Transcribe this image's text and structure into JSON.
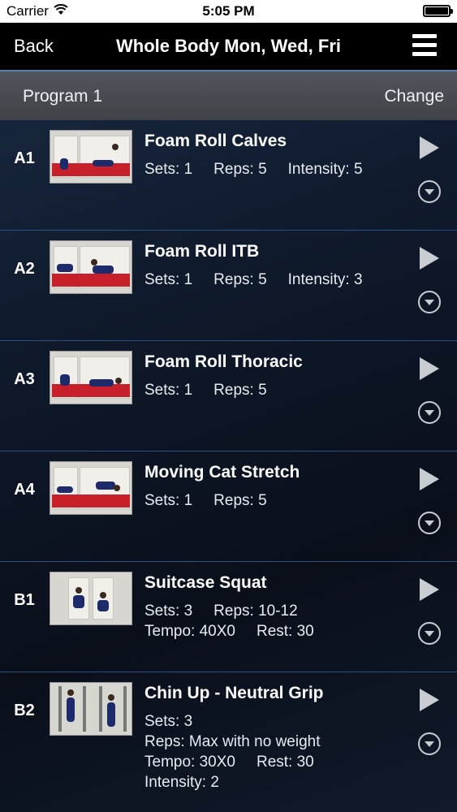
{
  "status_bar": {
    "carrier": "Carrier",
    "time": "5:05 PM",
    "battery_level": 1.0
  },
  "nav": {
    "back_label": "Back",
    "title": "Whole Body Mon, Wed, Fri",
    "menu_icon": "hamburger-menu-icon"
  },
  "program": {
    "label": "Program 1",
    "change_label": "Change"
  },
  "exercises": [
    {
      "code": "A1",
      "name": "Foam Roll Calves",
      "lines": [
        [
          "Sets: 1",
          "Reps: 5",
          "Intensity: 5"
        ]
      ]
    },
    {
      "code": "A2",
      "name": "Foam Roll ITB",
      "lines": [
        [
          "Sets: 1",
          "Reps: 5",
          "Intensity: 3"
        ]
      ]
    },
    {
      "code": "A3",
      "name": "Foam Roll Thoracic",
      "lines": [
        [
          "Sets: 1",
          "Reps: 5"
        ]
      ]
    },
    {
      "code": "A4",
      "name": "Moving Cat Stretch",
      "lines": [
        [
          "Sets: 1",
          "Reps: 5"
        ]
      ]
    },
    {
      "code": "B1",
      "name": "Suitcase Squat",
      "lines": [
        [
          "Sets: 3",
          "Reps: 10-12"
        ],
        [
          "Tempo: 40X0",
          "Rest: 30"
        ]
      ]
    },
    {
      "code": "B2",
      "name": "Chin Up - Neutral Grip",
      "lines": [
        [
          "Sets: 3"
        ],
        [
          "Reps: Max with no weight"
        ],
        [
          "Tempo: 30X0",
          "Rest: 30"
        ],
        [
          "Intensity: 2"
        ]
      ]
    }
  ],
  "colors": {
    "nav_bg": "#000000",
    "program_bar_bg": "#4a4e53",
    "row_divider": "#2f4f80",
    "icon_gray": "#c9ccd1",
    "mat_red": "#c8202a"
  }
}
